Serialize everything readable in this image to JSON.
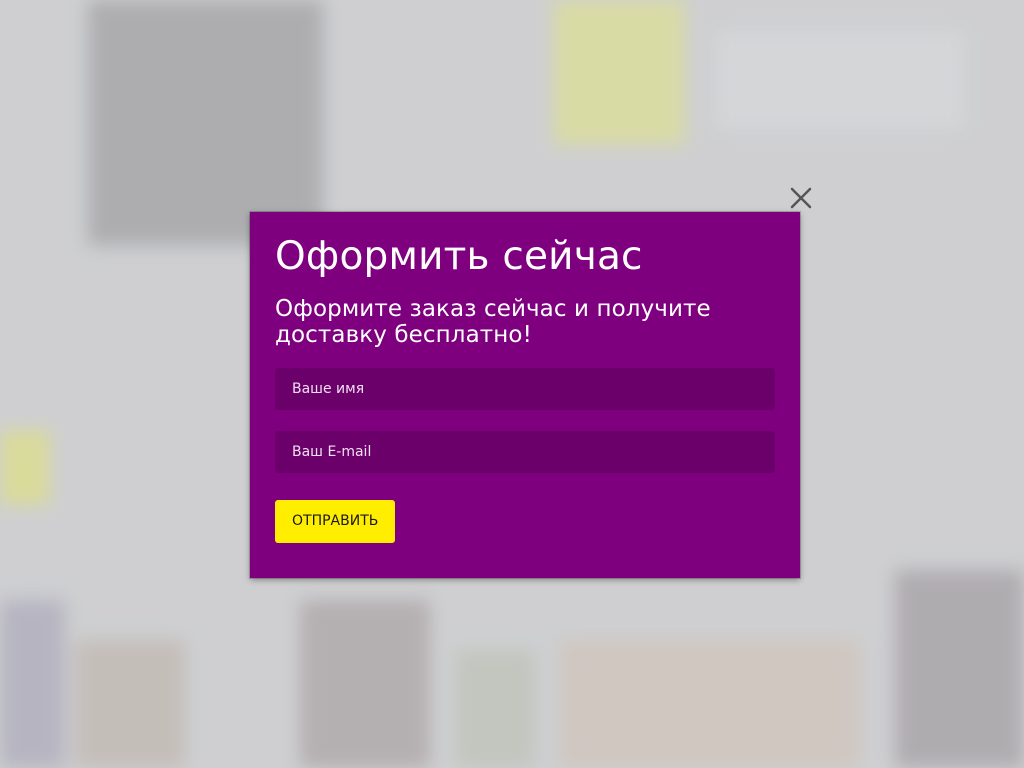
{
  "modal": {
    "title": "Оформить сейчас",
    "subtitle": "Оформите заказ сейчас и получите доставку бесплатно!",
    "name_placeholder": "Ваше имя",
    "email_placeholder": "Ваш E-mail",
    "submit_label": "ОТПРАВИТЬ"
  },
  "icons": {
    "close": "close-icon"
  },
  "colors": {
    "modal_background": "#7f007f",
    "input_background": "#6b006b",
    "button_background": "#ffee00",
    "backdrop": "#cfd0d2"
  }
}
